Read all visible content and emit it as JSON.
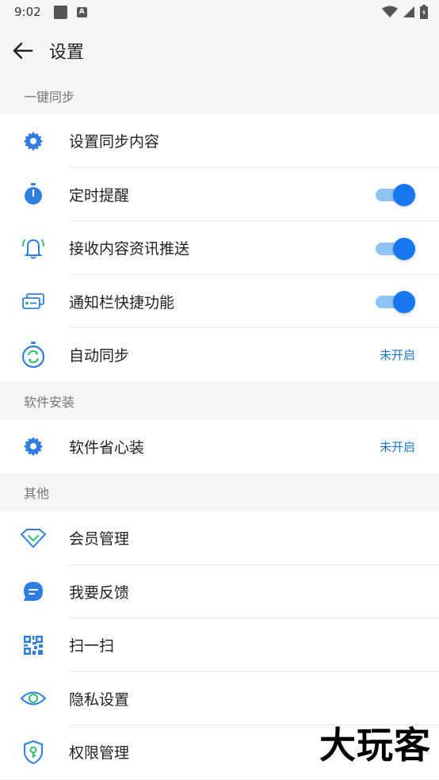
{
  "status_bar": {
    "time": "9:02"
  },
  "header": {
    "title": "设置"
  },
  "sections": [
    {
      "title": "一键同步",
      "items": [
        {
          "label": "设置同步内容",
          "icon": "gear-icon"
        },
        {
          "label": "定时提醒",
          "icon": "stopwatch-icon",
          "toggle": true
        },
        {
          "label": "接收内容资讯推送",
          "icon": "bell-icon",
          "toggle": true
        },
        {
          "label": "通知栏快捷功能",
          "icon": "notification-card-icon",
          "toggle": true
        },
        {
          "label": "自动同步",
          "icon": "sync-clock-icon",
          "status": "未开启"
        }
      ]
    },
    {
      "title": "软件安装",
      "items": [
        {
          "label": "软件省心装",
          "icon": "gear-icon",
          "status": "未开启"
        }
      ]
    },
    {
      "title": "其他",
      "items": [
        {
          "label": "会员管理",
          "icon": "diamond-icon"
        },
        {
          "label": "我要反馈",
          "icon": "chat-bubble-icon"
        },
        {
          "label": "扫一扫",
          "icon": "qr-code-icon"
        },
        {
          "label": "隐私设置",
          "icon": "eye-icon"
        },
        {
          "label": "权限管理",
          "icon": "shield-key-icon"
        }
      ]
    }
  ],
  "watermark": "大玩客",
  "colors": {
    "accent": "#1777f0",
    "icon_blue": "#2f7ee0",
    "status_blue": "#1976d2"
  }
}
